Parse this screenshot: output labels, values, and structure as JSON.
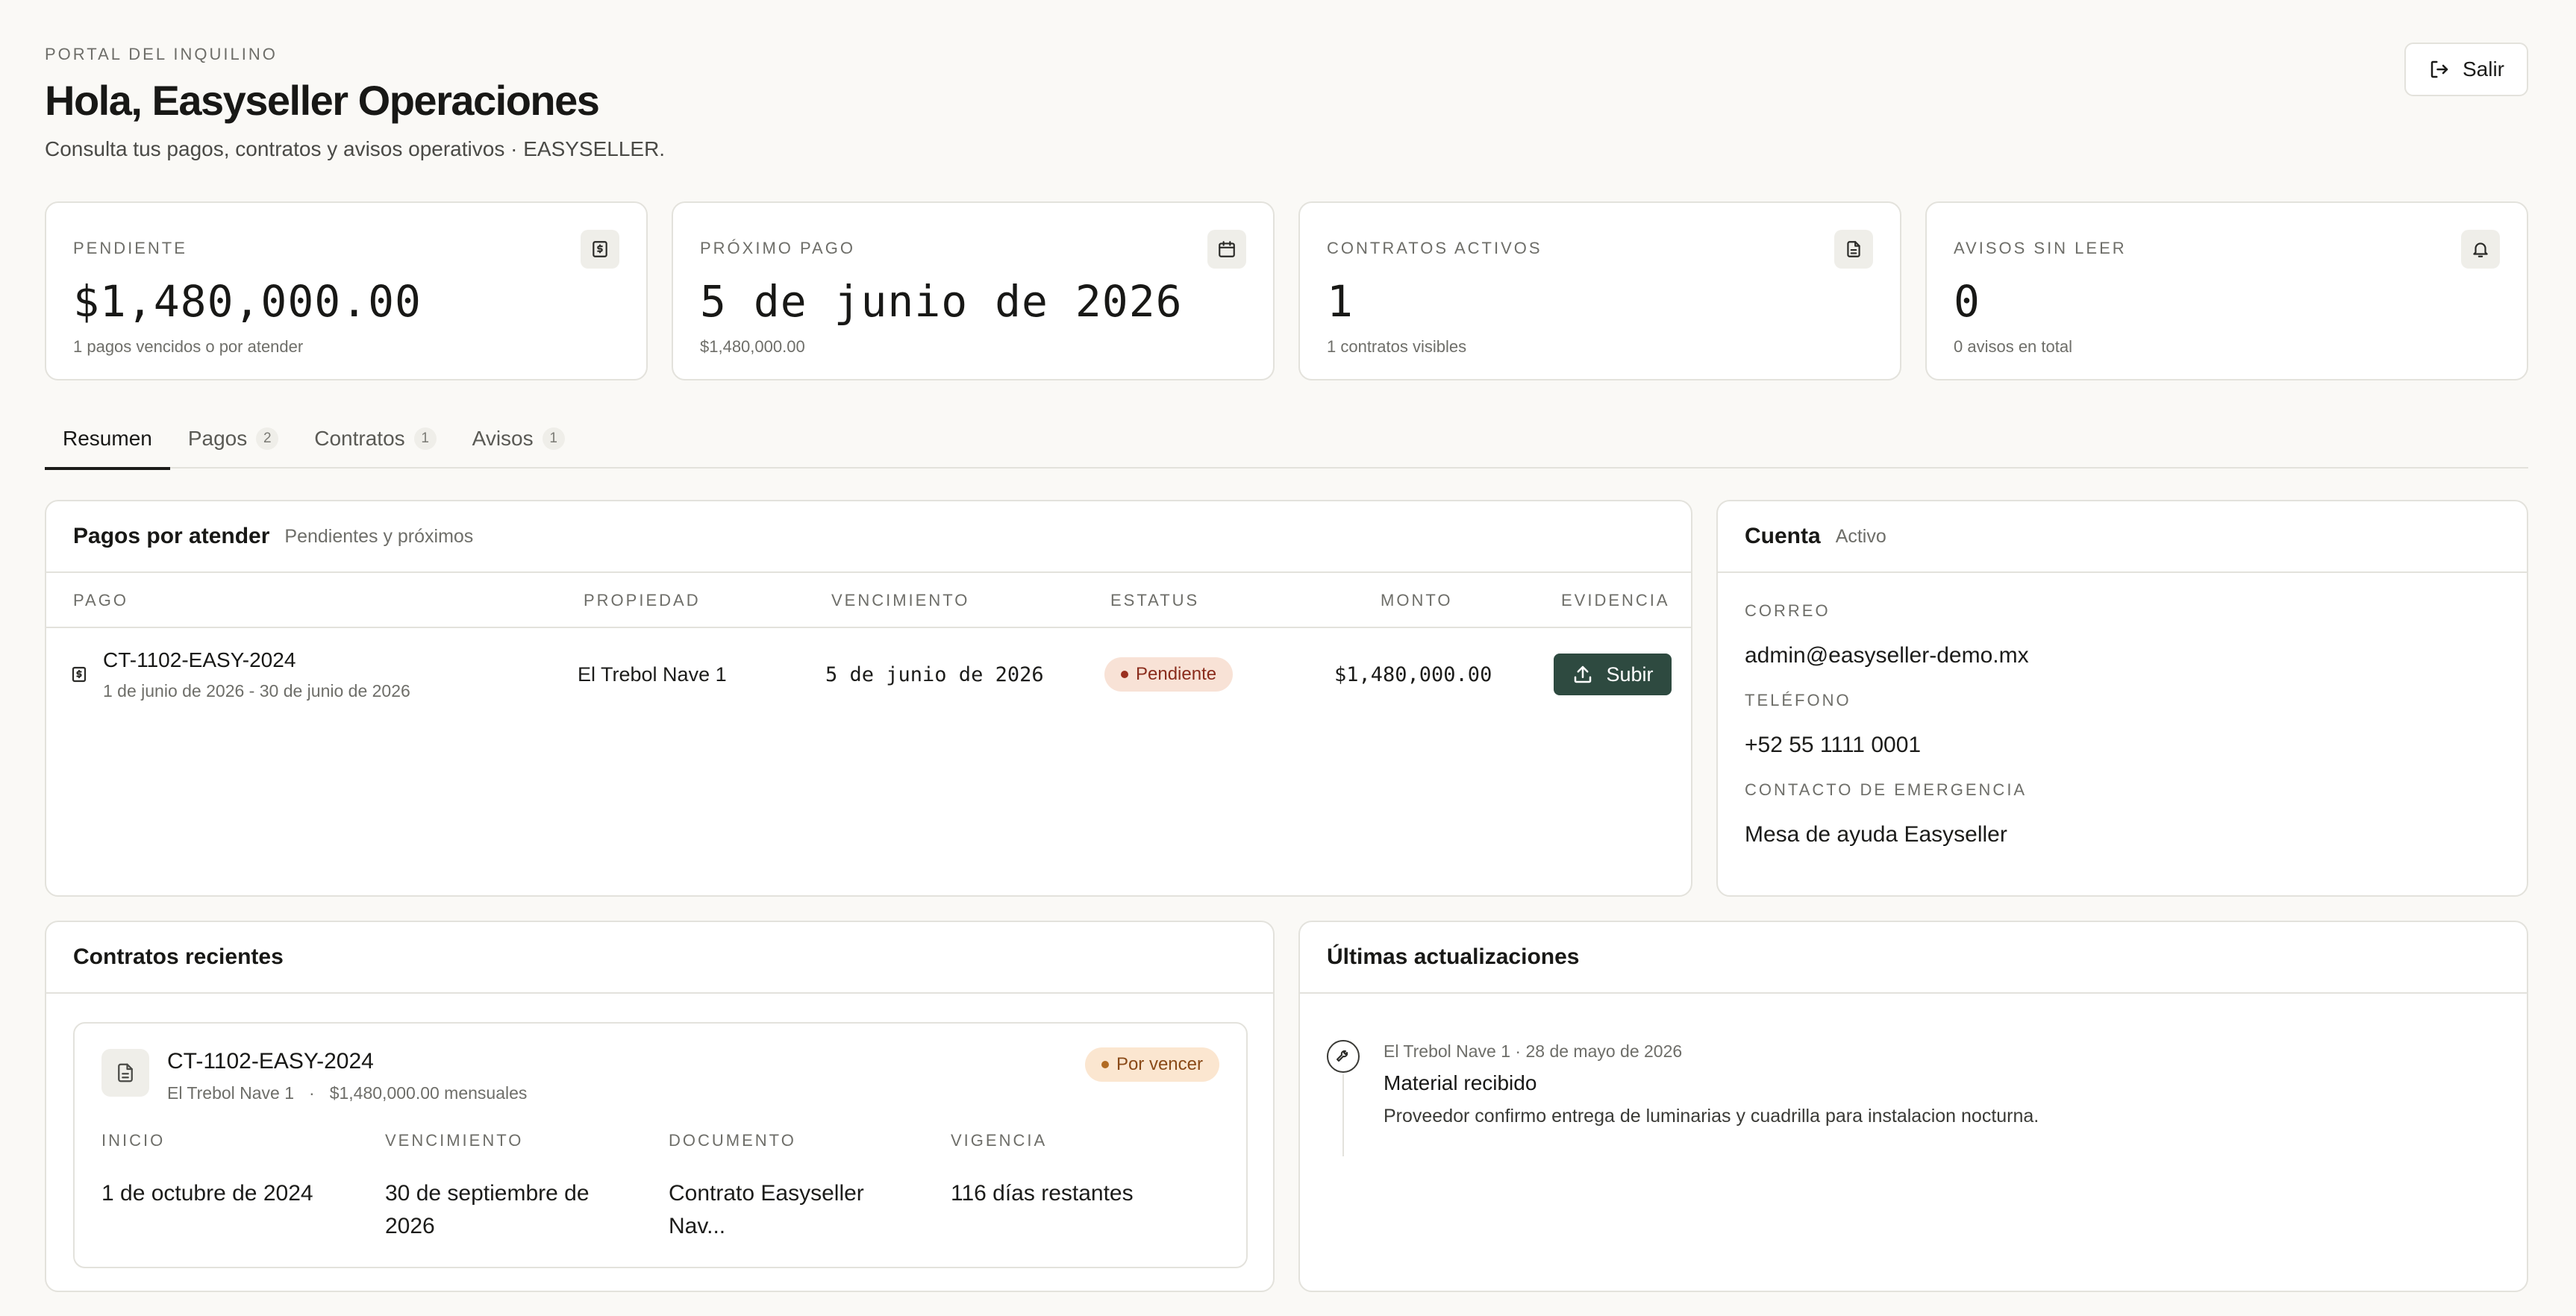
{
  "header": {
    "eyebrow": "PORTAL DEL INQUILINO",
    "title": "Hola, Easyseller Operaciones",
    "subtitle": "Consulta tus pagos, contratos y avisos operativos · EASYSELLER.",
    "logout_label": "Salir"
  },
  "stats": [
    {
      "label": "PENDIENTE",
      "value": "$1,480,000.00",
      "sub": "1 pagos vencidos o por atender",
      "icon": "dollar-doc-icon"
    },
    {
      "label": "PRÓXIMO PAGO",
      "value": "5 de junio de 2026",
      "sub": "$1,480,000.00",
      "icon": "calendar-icon"
    },
    {
      "label": "CONTRATOS ACTIVOS",
      "value": "1",
      "sub": "1 contratos visibles",
      "icon": "document-icon"
    },
    {
      "label": "AVISOS SIN LEER",
      "value": "0",
      "sub": "0 avisos en total",
      "icon": "bell-icon"
    }
  ],
  "tabs": [
    {
      "label": "Resumen",
      "count": ""
    },
    {
      "label": "Pagos",
      "count": "2"
    },
    {
      "label": "Contratos",
      "count": "1"
    },
    {
      "label": "Avisos",
      "count": "1"
    }
  ],
  "payments": {
    "title": "Pagos por atender",
    "subtitle": "Pendientes y próximos",
    "columns": {
      "pago": "PAGO",
      "propiedad": "PROPIEDAD",
      "vencimiento": "VENCIMIENTO",
      "estatus": "ESTATUS",
      "monto": "MONTO",
      "evidencia": "EVIDENCIA"
    },
    "rows": [
      {
        "code": "CT-1102-EASY-2024",
        "range": "1 de junio de 2026 - 30 de junio de 2026",
        "property": "El Trebol Nave 1",
        "due": "5 de junio de 2026",
        "status": "Pendiente",
        "amount": "$1,480,000.00",
        "action": "Subir"
      }
    ]
  },
  "account": {
    "title": "Cuenta",
    "status": "Activo",
    "email_label": "CORREO",
    "email": "admin@easyseller-demo.mx",
    "phone_label": "TELÉFONO",
    "phone": "+52 55 1111 0001",
    "emergency_label": "CONTACTO DE EMERGENCIA",
    "emergency": "Mesa de ayuda Easyseller"
  },
  "contracts": {
    "title": "Contratos recientes",
    "items": [
      {
        "code": "CT-1102-EASY-2024",
        "property": "El Trebol Nave 1",
        "separator": "·",
        "rent": "$1,480,000.00 mensuales",
        "status": "Por vencer",
        "start_label": "INICIO",
        "start": "1 de octubre de 2024",
        "end_label": "VENCIMIENTO",
        "end": "30 de septiembre de 2026",
        "doc_label": "DOCUMENTO",
        "doc": "Contrato Easyseller Nav...",
        "term_label": "VIGENCIA",
        "term": "116 días restantes"
      }
    ]
  },
  "updates": {
    "title": "Últimas actualizaciones",
    "items": [
      {
        "meta": "El Trebol Nave 1 · 28 de mayo de 2026",
        "title": "Material recibido",
        "body": "Proveedor confirmo entrega de luminarias y cuadrilla para instalacion nocturna.",
        "icon": "wrench-icon"
      }
    ]
  }
}
